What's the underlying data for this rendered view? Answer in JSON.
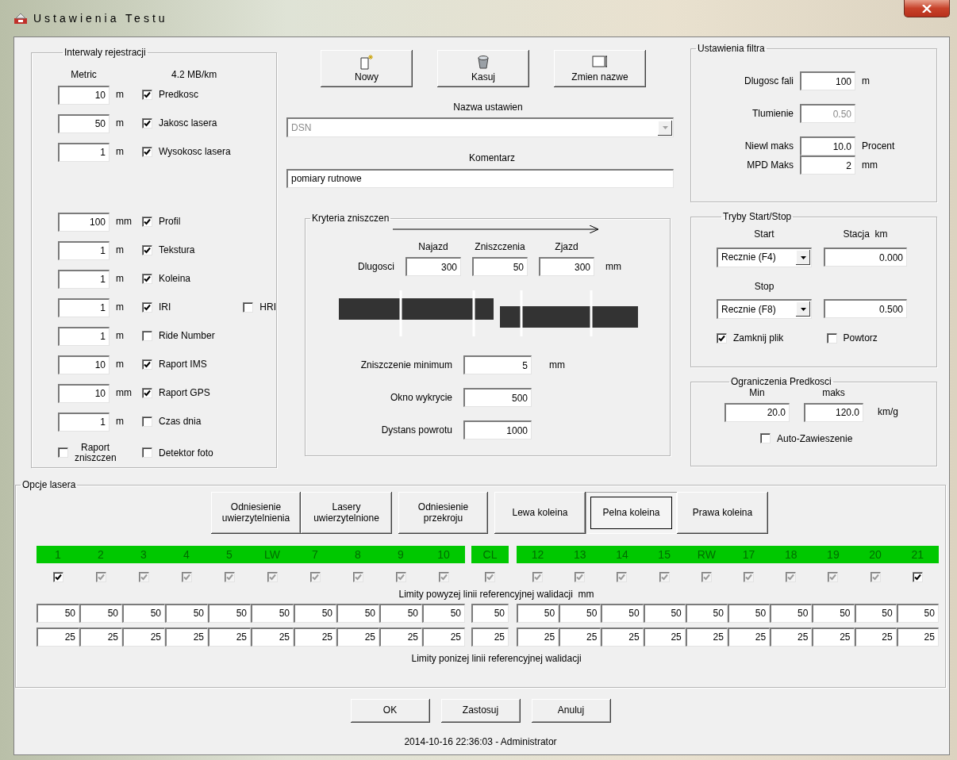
{
  "window": {
    "title": "Ustawienia Testu"
  },
  "intervals": {
    "title": "Interwaly rejestracji",
    "col_1": "Metric",
    "col_2": "4.2 MB/km",
    "row_groups": [
      [
        {
          "kind": "field",
          "value": "10",
          "unit": "m",
          "label": "Predkosc",
          "checked": true
        },
        {
          "kind": "field",
          "value": "50",
          "unit": "m",
          "label": "Jakosc lasera",
          "checked": true
        },
        {
          "kind": "field",
          "value": "1",
          "unit": "m",
          "label": "Wysokosc lasera",
          "checked": true
        }
      ],
      [
        {
          "kind": "field",
          "value": "100",
          "unit": "mm",
          "label": "Profil",
          "checked": true
        },
        {
          "kind": "field",
          "value": "1",
          "unit": "m",
          "label": "Tekstura",
          "checked": true
        },
        {
          "kind": "field",
          "value": "1",
          "unit": "m",
          "label": "Koleina",
          "checked": true
        },
        {
          "kind": "field",
          "value": "1",
          "unit": "m",
          "label": "IRI",
          "checked": true,
          "extra": {
            "label": "HRI",
            "checked": false
          }
        },
        {
          "kind": "field",
          "value": "1",
          "unit": "m",
          "label": "Ride Number",
          "checked": false
        },
        {
          "kind": "field",
          "value": "10",
          "unit": "m",
          "label": "Raport IMS",
          "checked": true
        },
        {
          "kind": "field",
          "value": "10",
          "unit": "mm",
          "label": "Raport GPS",
          "checked": true
        },
        {
          "kind": "field",
          "value": "1",
          "unit": "m",
          "label": "Czas dnia",
          "checked": false
        }
      ]
    ],
    "bottom_checks": [
      {
        "label": "Raport zniszczen",
        "checked": false
      },
      {
        "label": "Detektor foto",
        "checked": false
      }
    ]
  },
  "toolbar": [
    {
      "kind": "new",
      "label": "Nowy"
    },
    {
      "kind": "delete",
      "label": "Kasuj"
    },
    {
      "kind": "rename",
      "label": "Zmien nazwe"
    }
  ],
  "preset": {
    "label": "Nazwa ustawien",
    "value": "DSN",
    "disabled": true
  },
  "comment": {
    "label": "Komentarz",
    "value": "pomiary rutnowe"
  },
  "damage": {
    "title": "Kryteria zniszczen",
    "columns": [
      "Najazd",
      "Zniszczenia",
      "Zjazd"
    ],
    "row_label": "Dlugosci",
    "values": [
      "300",
      "50",
      "300"
    ],
    "unit": "mm",
    "fields": [
      {
        "label": "Zniszczenie minimum",
        "value": "5",
        "unit": "mm"
      },
      {
        "label": "Okno wykrycie",
        "value": "500"
      },
      {
        "label": "Dystans powrotu",
        "value": "1000"
      }
    ]
  },
  "filter": {
    "title": "Ustawienia filtra",
    "fields": [
      {
        "label": "Dlugosc fali",
        "value": "100",
        "unit": "m",
        "disabled": false
      },
      {
        "label": "Tlumienie",
        "value": "0.50",
        "disabled": true
      },
      {
        "label": "Niewl maks",
        "value": "10.0",
        "unit": "Procent",
        "disabled": false
      },
      {
        "label": "MPD Maks",
        "value": "2",
        "unit": "mm",
        "disabled": false
      }
    ]
  },
  "start_stop": {
    "title": "Tryby Start/Stop",
    "mode_header": "Start",
    "station_header": "Stacja  km",
    "start": {
      "value": "Recznie (F4)",
      "station": "0.000"
    },
    "stop_label": "Stop",
    "stop": {
      "value": "Recznie (F8)",
      "station": "0.500"
    },
    "options": [
      {
        "label": "Zamknij plik",
        "checked": true
      },
      {
        "label": "Powtorz",
        "checked": false
      }
    ]
  },
  "speed": {
    "title": "Ograniczenia Predkosci",
    "min_label": "Min",
    "max_label": "maks",
    "min": "20.0",
    "max": "120.0",
    "unit": "km/g",
    "auto": {
      "label": "Auto-Zawieszenie",
      "checked": false
    }
  },
  "laser": {
    "title": "Opcje lasera",
    "buttons": [
      {
        "label": "Odniesienie uwierzytelnienia"
      },
      {
        "label": "Lasery uwierzytelnione"
      },
      {
        "label": "Odniesienie przekroju"
      }
    ],
    "views": [
      {
        "label": "Lewa koleina",
        "selected": false
      },
      {
        "label": "Pelna koleina",
        "selected": true
      },
      {
        "label": "Prawa koleina",
        "selected": false
      }
    ],
    "channel_groups": [
      [
        {
          "label": "1",
          "checked": true,
          "disabled": false,
          "upper": "50",
          "lower": "25"
        },
        {
          "label": "2",
          "checked": true,
          "disabled": true,
          "upper": "50",
          "lower": "25"
        },
        {
          "label": "3",
          "checked": true,
          "disabled": true,
          "upper": "50",
          "lower": "25"
        },
        {
          "label": "4",
          "checked": true,
          "disabled": true,
          "upper": "50",
          "lower": "25"
        },
        {
          "label": "5",
          "checked": true,
          "disabled": true,
          "upper": "50",
          "lower": "25"
        },
        {
          "label": "LW",
          "checked": true,
          "disabled": true,
          "upper": "50",
          "lower": "25"
        },
        {
          "label": "7",
          "checked": true,
          "disabled": true,
          "upper": "50",
          "lower": "25"
        },
        {
          "label": "8",
          "checked": true,
          "disabled": true,
          "upper": "50",
          "lower": "25"
        },
        {
          "label": "9",
          "checked": true,
          "disabled": true,
          "upper": "50",
          "lower": "25"
        },
        {
          "label": "10",
          "checked": true,
          "disabled": true,
          "upper": "50",
          "lower": "25"
        }
      ],
      [
        {
          "label": "CL",
          "checked": true,
          "disabled": true,
          "upper": "50",
          "lower": "25"
        }
      ],
      [
        {
          "label": "12",
          "checked": true,
          "disabled": true,
          "upper": "50",
          "lower": "25"
        },
        {
          "label": "13",
          "checked": true,
          "disabled": true,
          "upper": "50",
          "lower": "25"
        },
        {
          "label": "14",
          "checked": true,
          "disabled": true,
          "upper": "50",
          "lower": "25"
        },
        {
          "label": "15",
          "checked": true,
          "disabled": true,
          "upper": "50",
          "lower": "25"
        },
        {
          "label": "RW",
          "checked": true,
          "disabled": true,
          "upper": "50",
          "lower": "25"
        },
        {
          "label": "17",
          "checked": true,
          "disabled": true,
          "upper": "50",
          "lower": "25"
        },
        {
          "label": "18",
          "checked": true,
          "disabled": true,
          "upper": "50",
          "lower": "25"
        },
        {
          "label": "19",
          "checked": true,
          "disabled": true,
          "upper": "50",
          "lower": "25"
        },
        {
          "label": "20",
          "checked": true,
          "disabled": true,
          "upper": "50",
          "lower": "25"
        },
        {
          "label": "21",
          "checked": true,
          "disabled": false,
          "upper": "50",
          "lower": "25"
        }
      ]
    ],
    "upper_caption": "Limity powyzej linii referencyjnej walidacji  mm",
    "lower_caption": "Limity ponizej linii referencyjnej walidacji"
  },
  "footer_buttons": [
    {
      "label": "OK"
    },
    {
      "label": "Zastosuj"
    },
    {
      "label": "Anuluj"
    }
  ],
  "status": "2014-10-16 22:36:03 - Administrator"
}
